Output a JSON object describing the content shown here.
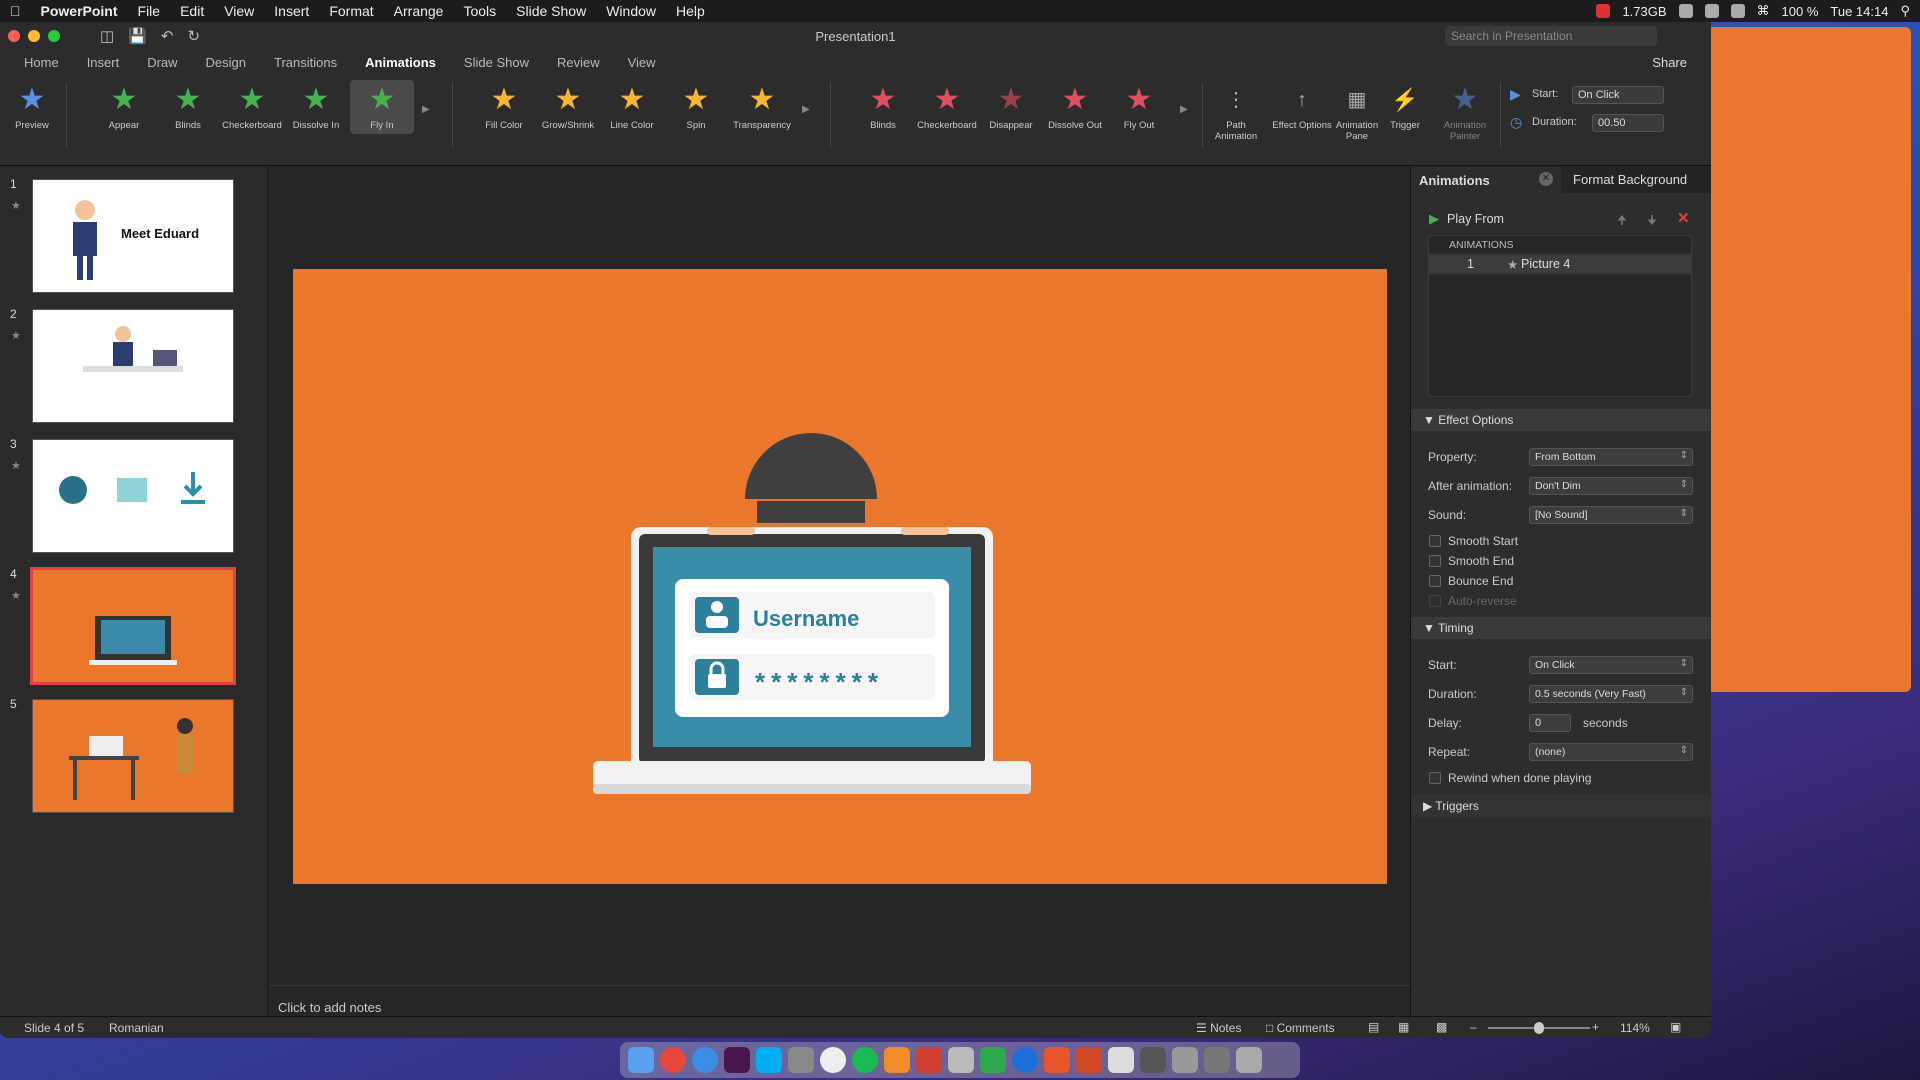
{
  "menubar": {
    "app": "PowerPoint",
    "items": [
      "File",
      "Edit",
      "View",
      "Insert",
      "Format",
      "Arrange",
      "Tools",
      "Slide Show",
      "Window",
      "Help"
    ],
    "memory": "1.73GB",
    "battery": "100 %",
    "time": "Tue 14:14"
  },
  "window": {
    "title": "Presentation1",
    "search_placeholder": "Search in Presentation"
  },
  "tabs": [
    "Home",
    "Insert",
    "Draw",
    "Design",
    "Transitions",
    "Animations",
    "Slide Show",
    "Review",
    "View"
  ],
  "share": "Share",
  "ribbon": {
    "preview": "Preview",
    "entrance": [
      "Appear",
      "Blinds",
      "Checkerboard",
      "Dissolve In",
      "Fly In"
    ],
    "emphasis": [
      "Fill Color",
      "Grow/Shrink",
      "Line Color",
      "Spin",
      "Transparency"
    ],
    "exit": [
      "Blinds",
      "Checkerboard",
      "Disappear",
      "Dissolve Out",
      "Fly Out"
    ],
    "path": "Path Animation",
    "effect": "Effect Options",
    "pane": "Animation Pane",
    "trigger": "Trigger",
    "painter": "Animation Painter",
    "start_label": "Start:",
    "start_value": "On Click",
    "duration_label": "Duration:",
    "duration_value": "00.50"
  },
  "thumbs": [
    {
      "n": "1",
      "text": "Meet Eduard"
    },
    {
      "n": "2"
    },
    {
      "n": "3"
    },
    {
      "n": "4"
    },
    {
      "n": "5"
    }
  ],
  "slide": {
    "username": "Username",
    "password": "********"
  },
  "notes": "Click to add notes",
  "pane": {
    "tab1": "Animations",
    "tab2": "Format Background",
    "play_from": "Play From",
    "list_header": "ANIMATIONS",
    "item_num": "1",
    "item_name": "Picture 4",
    "effect_options": "Effect Options",
    "property_label": "Property:",
    "property_value": "From Bottom",
    "after_label": "After animation:",
    "after_value": "Don't Dim",
    "sound_label": "Sound:",
    "sound_value": "[No Sound]",
    "smooth_start": "Smooth Start",
    "smooth_end": "Smooth End",
    "bounce_end": "Bounce End",
    "auto_reverse": "Auto-reverse",
    "timing": "Timing",
    "start_label": "Start:",
    "start_value": "On Click",
    "duration_label": "Duration:",
    "duration_value": "0.5 seconds (Very Fast)",
    "delay_label": "Delay:",
    "delay_value": "0",
    "seconds": "seconds",
    "repeat_label": "Repeat:",
    "repeat_value": "(none)",
    "rewind": "Rewind when done playing",
    "triggers": "Triggers"
  },
  "status": {
    "slide": "Slide 4 of 5",
    "lang": "Romanian",
    "notes": "Notes",
    "comments": "Comments",
    "zoom": "114%"
  },
  "colors": {
    "accent_orange": "#ea772c",
    "pane_bg": "#2d2d2d",
    "entrance_green": "#4caf50",
    "emphasis_yellow": "#f2b830",
    "exit_red": "#e05060"
  }
}
